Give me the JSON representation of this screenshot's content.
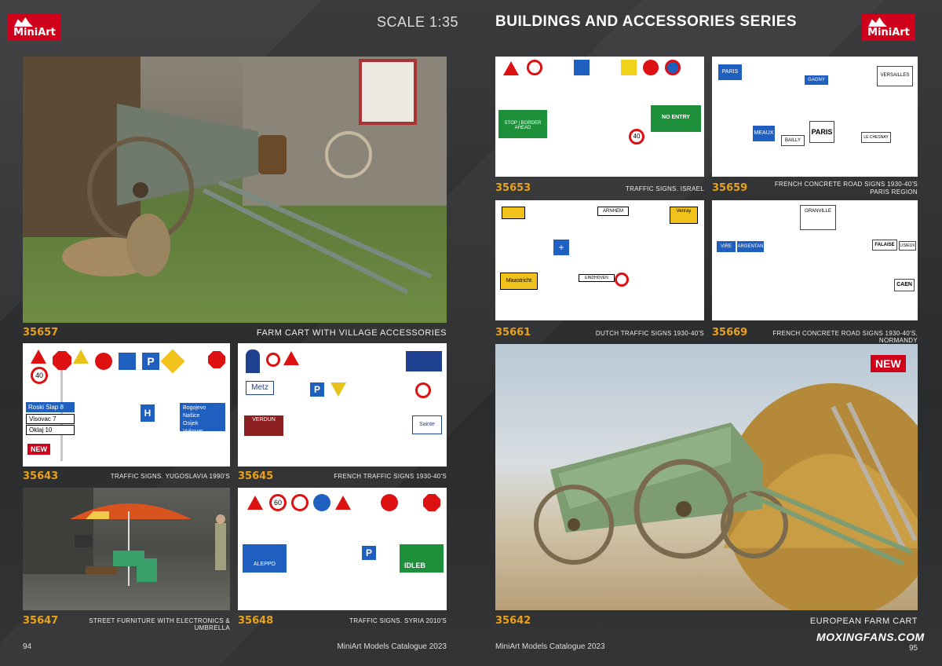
{
  "header": {
    "brand": "MiniArt",
    "scale": "SCALE 1:35",
    "series": "BUILDINGS AND ACCESSORIES SERIES"
  },
  "products": {
    "p35657": {
      "code": "35657",
      "name": "FARM CART WITH VILLAGE ACCESSORIES"
    },
    "p35643": {
      "code": "35643",
      "name": "TRAFFIC SIGNS. YUGOSLAVIA 1990's",
      "badge": "NEW"
    },
    "p35645": {
      "code": "35645",
      "name": "FRENCH TRAFFIC SIGNS 1930-40's"
    },
    "p35647": {
      "code": "35647",
      "name": "STREET FURNITURE WITH ELECTRONICS & UMBRELLA"
    },
    "p35648": {
      "code": "35648",
      "name": "TRAFFIC SIGNS. SYRIA 2010's"
    },
    "p35653": {
      "code": "35653",
      "name": "TRAFFIC SIGNS. ISRAEL"
    },
    "p35659": {
      "code": "35659",
      "name": "FRENCH CONCRETE ROAD SIGNS 1930-40's",
      "name2": "PARIS REGION"
    },
    "p35661": {
      "code": "35661",
      "name": "DUTCH TRAFFIC SIGNS 1930-40's"
    },
    "p35669": {
      "code": "35669",
      "name": "FRENCH CONCRETE ROAD SIGNS 1930-40's. NORMANDY"
    },
    "p35642": {
      "code": "35642",
      "name": "EUROPEAN FARM CART",
      "badge": "NEW"
    }
  },
  "footer": {
    "left_page": "94",
    "left_title": "MiniArt Models Catalogue 2023",
    "right_title": "MiniArt Models Catalogue 2023",
    "right_page": "95",
    "watermark": "MOXINGFANS.COM"
  },
  "sign_text": {
    "yu_roski": "Roski Slap 8",
    "yu_visovac": "Visovac 7",
    "yu_oklaj": "Oklaj 10",
    "yu_bogojevo": "Bogojevo",
    "yu_nasice": "Našice",
    "yu_osijek": "Osijek",
    "yu_vukovar": "Vukovar",
    "fr_metz": "Metz",
    "fr_verdun": "VERDUN",
    "fr_sainte": "Sainte",
    "il_stop": "STOP | BORDER AHEAD",
    "il_noentry": "NO ENTRY",
    "nl_maastricht": "Maastricht",
    "nl_eindhoven": "EINDHOVEN",
    "nl_arnhem": "ARNHEM",
    "nl_venray": "Venray",
    "pr_paris": "PARIS",
    "pr_gagny": "GAGNY",
    "pr_meaux": "MEAUX",
    "pr_bailly": "BAILLY",
    "pr_lechesnay": "LE CHESNAY",
    "pr_versailles": "VERSAILLES",
    "no_vire": "VIRE",
    "no_argentan": "ARGENTAN",
    "no_caen": "CAEN",
    "no_falaise": "FALAISE",
    "no_lisieux": "LISIEUX",
    "no_granville": "GRANVILLE",
    "sy_aleppo": "ALEPPO",
    "sy_idleb": "IDLEB"
  },
  "colors": {
    "accent": "#e8a11b",
    "brand": "#d0021b",
    "sign_red": "#d11a1a",
    "sign_blue": "#1f5fbf"
  }
}
